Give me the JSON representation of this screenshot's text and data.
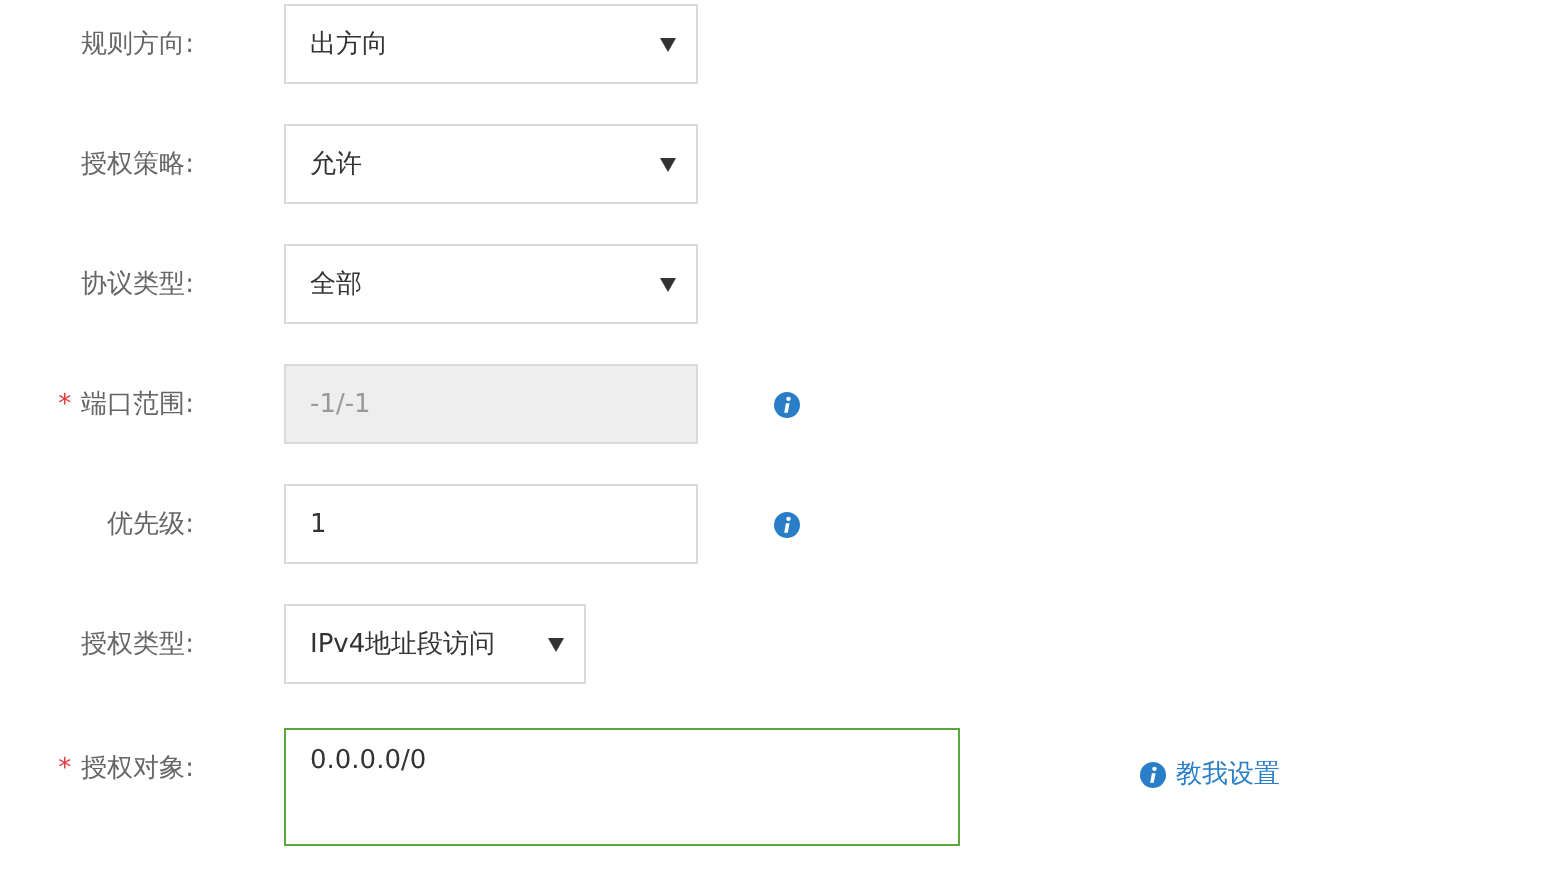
{
  "fields": [
    {
      "kind": "select",
      "label": "规则方向:",
      "value": "出方向"
    },
    {
      "kind": "select",
      "label": "授权策略:",
      "value": "允许"
    },
    {
      "kind": "select",
      "label": "协议类型:",
      "value": "全部"
    },
    {
      "kind": "input",
      "required_mark": "*",
      "label": "端口范围:",
      "value": "-1/-1",
      "disabled": true,
      "info": true
    },
    {
      "kind": "input",
      "label": "优先级:",
      "value": "1",
      "info": true
    },
    {
      "kind": "short-select",
      "label": "授权类型:",
      "value": "IPv4地址段访问"
    },
    {
      "kind": "textarea",
      "required_mark": "*",
      "label": "授权对象:",
      "value": "0.0.0.0/0",
      "focused": true,
      "info": true,
      "link": "教我设置"
    }
  ]
}
